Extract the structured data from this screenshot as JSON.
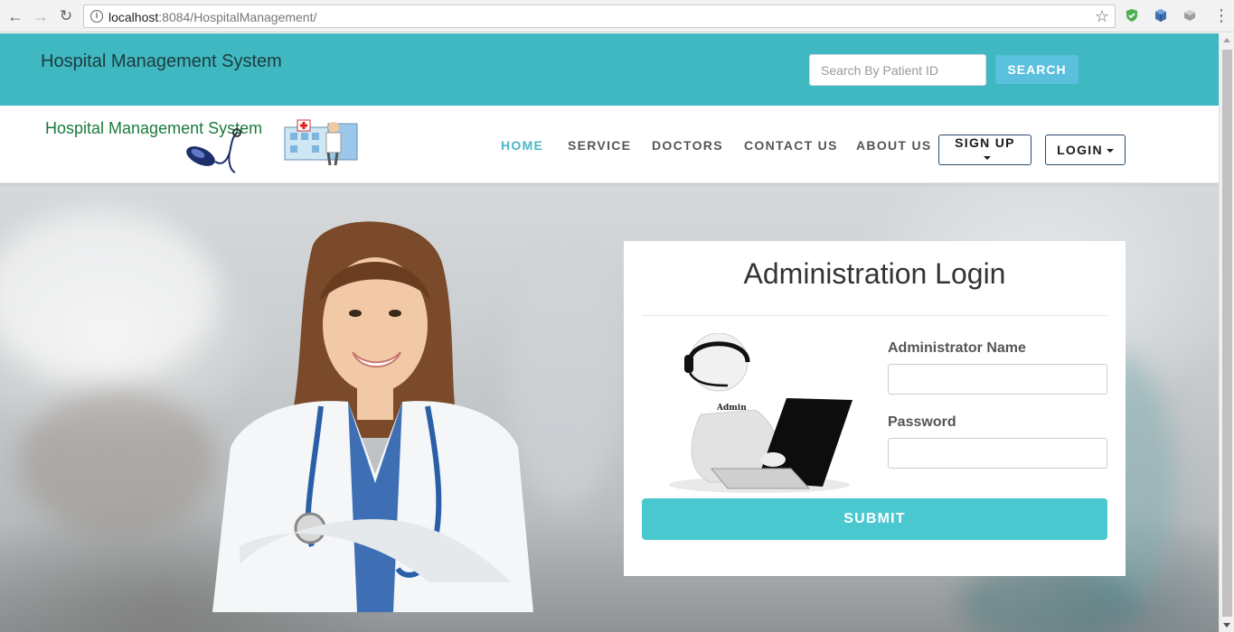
{
  "browser": {
    "url_host": "localhost",
    "url_path": ":8084/HospitalManagement/"
  },
  "header": {
    "title": "Hospital Management System",
    "search_placeholder": "Search By Patient ID",
    "search_button": "SEARCH"
  },
  "logo": {
    "text": "Hospital Management System"
  },
  "nav": {
    "items": [
      {
        "label": "HOME",
        "active": true
      },
      {
        "label": "SERVICE",
        "active": false
      },
      {
        "label": "DOCTORS",
        "active": false
      },
      {
        "label": "CONTACT US",
        "active": false
      },
      {
        "label": "ABOUT US",
        "active": false
      }
    ],
    "signup": "SIGN UP",
    "login": "LOGIN"
  },
  "login_form": {
    "title": "Administration Login",
    "illustration_label": "Admin",
    "name_label": "Administrator Name",
    "name_value": "",
    "password_label": "Password",
    "password_value": "",
    "submit": "SUBMIT"
  },
  "colors": {
    "header_bg": "#3fb8c1",
    "accent": "#4cb8c3",
    "search_button": "#5bc0de",
    "submit_button": "#4ac8cf"
  }
}
